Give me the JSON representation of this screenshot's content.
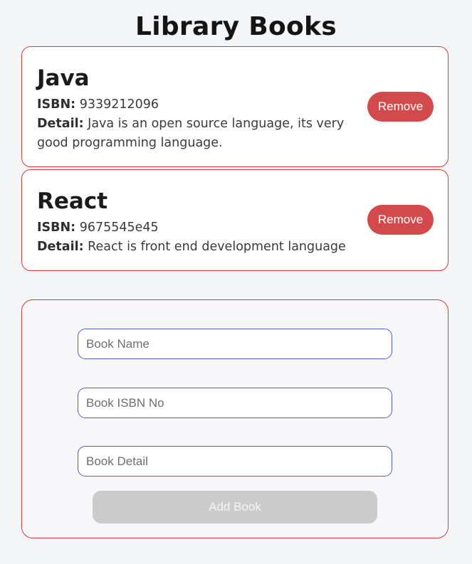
{
  "page": {
    "title": "Library Books"
  },
  "books": [
    {
      "name": "Java",
      "isbn_label": "ISBN:",
      "isbn": "9339212096",
      "detail_label": "Detail:",
      "detail": "Java is an open source language, its very good programming language.",
      "remove_label": "Remove"
    },
    {
      "name": "React",
      "isbn_label": "ISBN:",
      "isbn": "9675545e45",
      "detail_label": "Detail:",
      "detail": "React is front end development language",
      "remove_label": "Remove"
    }
  ],
  "form": {
    "name_placeholder": "Book Name",
    "isbn_placeholder": "Book ISBN No",
    "detail_placeholder": "Book Detail",
    "name_value": "",
    "isbn_value": "",
    "detail_value": "",
    "submit_label": "Add Book",
    "submit_disabled": true
  },
  "colors": {
    "background": "#f4f5f7",
    "card_border": "#d73a3a",
    "remove_button": "#d24a4c",
    "input_border": "#4a5fc9",
    "submit_disabled": "#cbcbcb"
  }
}
